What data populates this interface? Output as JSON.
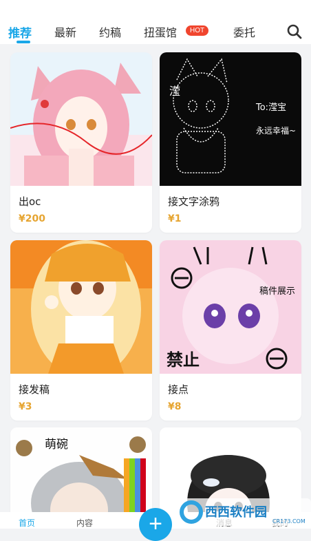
{
  "tabs": [
    {
      "label": "推荐",
      "active": true
    },
    {
      "label": "最新",
      "active": false
    },
    {
      "label": "约稿",
      "active": false
    },
    {
      "label": "扭蛋馆",
      "active": false,
      "badge": "HOT"
    },
    {
      "label": "委托",
      "active": false
    }
  ],
  "accent_color": "#1aa7e8",
  "price_color": "#e6a532",
  "icons": [
    "search-icon",
    "plus-icon"
  ],
  "cards": [
    {
      "title": "出oc",
      "price": "¥200"
    },
    {
      "title": "接文字涂鸦",
      "price": "¥1",
      "image_text": {
        "line1": "滢",
        "line2": "To:滢宝",
        "line3": "永远幸福~"
      }
    },
    {
      "title": "接发稿",
      "price": "¥3"
    },
    {
      "title": "接点",
      "price": "¥8",
      "image_text": {
        "stamp": "禁止",
        "tag": "稿件展示"
      }
    },
    {
      "title": "",
      "price": "",
      "image_text": {
        "tag": "萌碗"
      }
    },
    {
      "title": "",
      "price": ""
    }
  ],
  "bottom_nav": {
    "home": "首页",
    "content": "内容",
    "messages": "消息",
    "mine": "我的"
  },
  "watermark": {
    "brand": "西西软件园",
    "url": "CR173.COM"
  }
}
